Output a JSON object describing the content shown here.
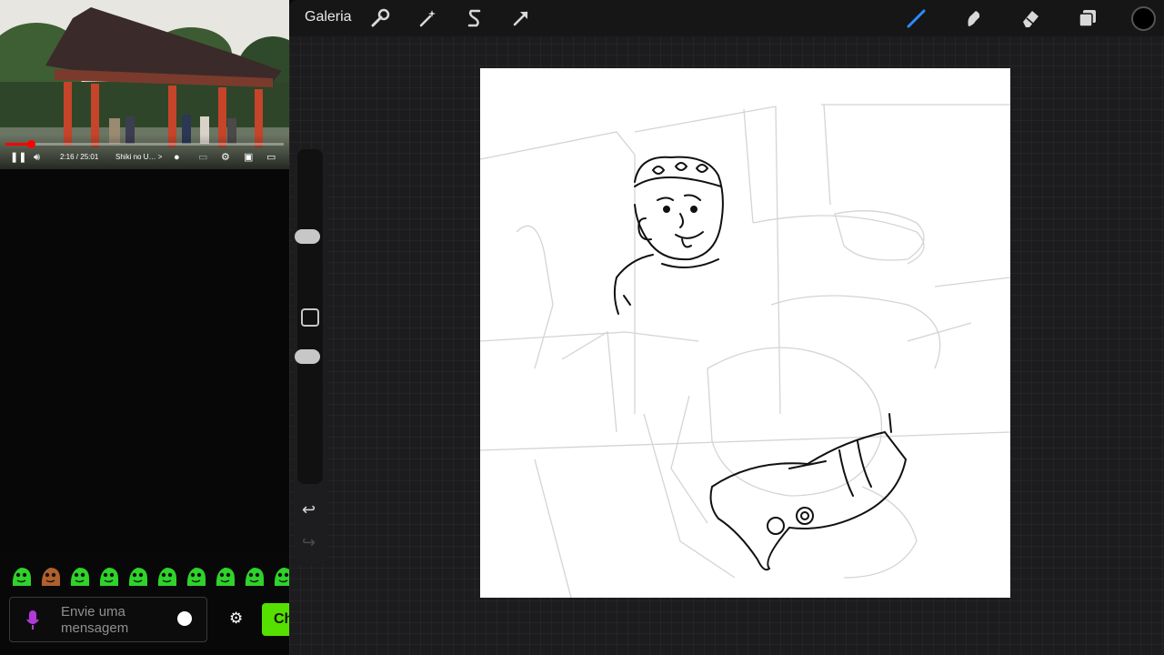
{
  "video": {
    "time_current": "2:16",
    "time_separator": " / ",
    "time_total": "25:01",
    "chapter": "Shiki no U…",
    "chapter_chevron": ">",
    "progress_fraction": 0.09,
    "icons": [
      "pause-icon",
      "volume-icon",
      "autoplay-toggle",
      "subtitles-icon",
      "settings-icon",
      "miniplayer-icon",
      "airplay-icon"
    ]
  },
  "chat": {
    "placeholder": "Envie uma mensagem",
    "send_label": "Chat",
    "emote_color": "#2fd32a",
    "icons": [
      "microphone-icon",
      "emoji-icon",
      "settings-icon"
    ]
  },
  "procreate": {
    "gallery_label": "Galeria",
    "brush_color": "#000000",
    "accent": "#2a8cff",
    "tools_left": [
      "wrench-icon",
      "magic-wand-icon",
      "selection-icon",
      "transform-arrow-icon"
    ],
    "tools_right": [
      "brush-icon",
      "smudge-icon",
      "eraser-icon",
      "layers-icon",
      "color-well"
    ]
  }
}
